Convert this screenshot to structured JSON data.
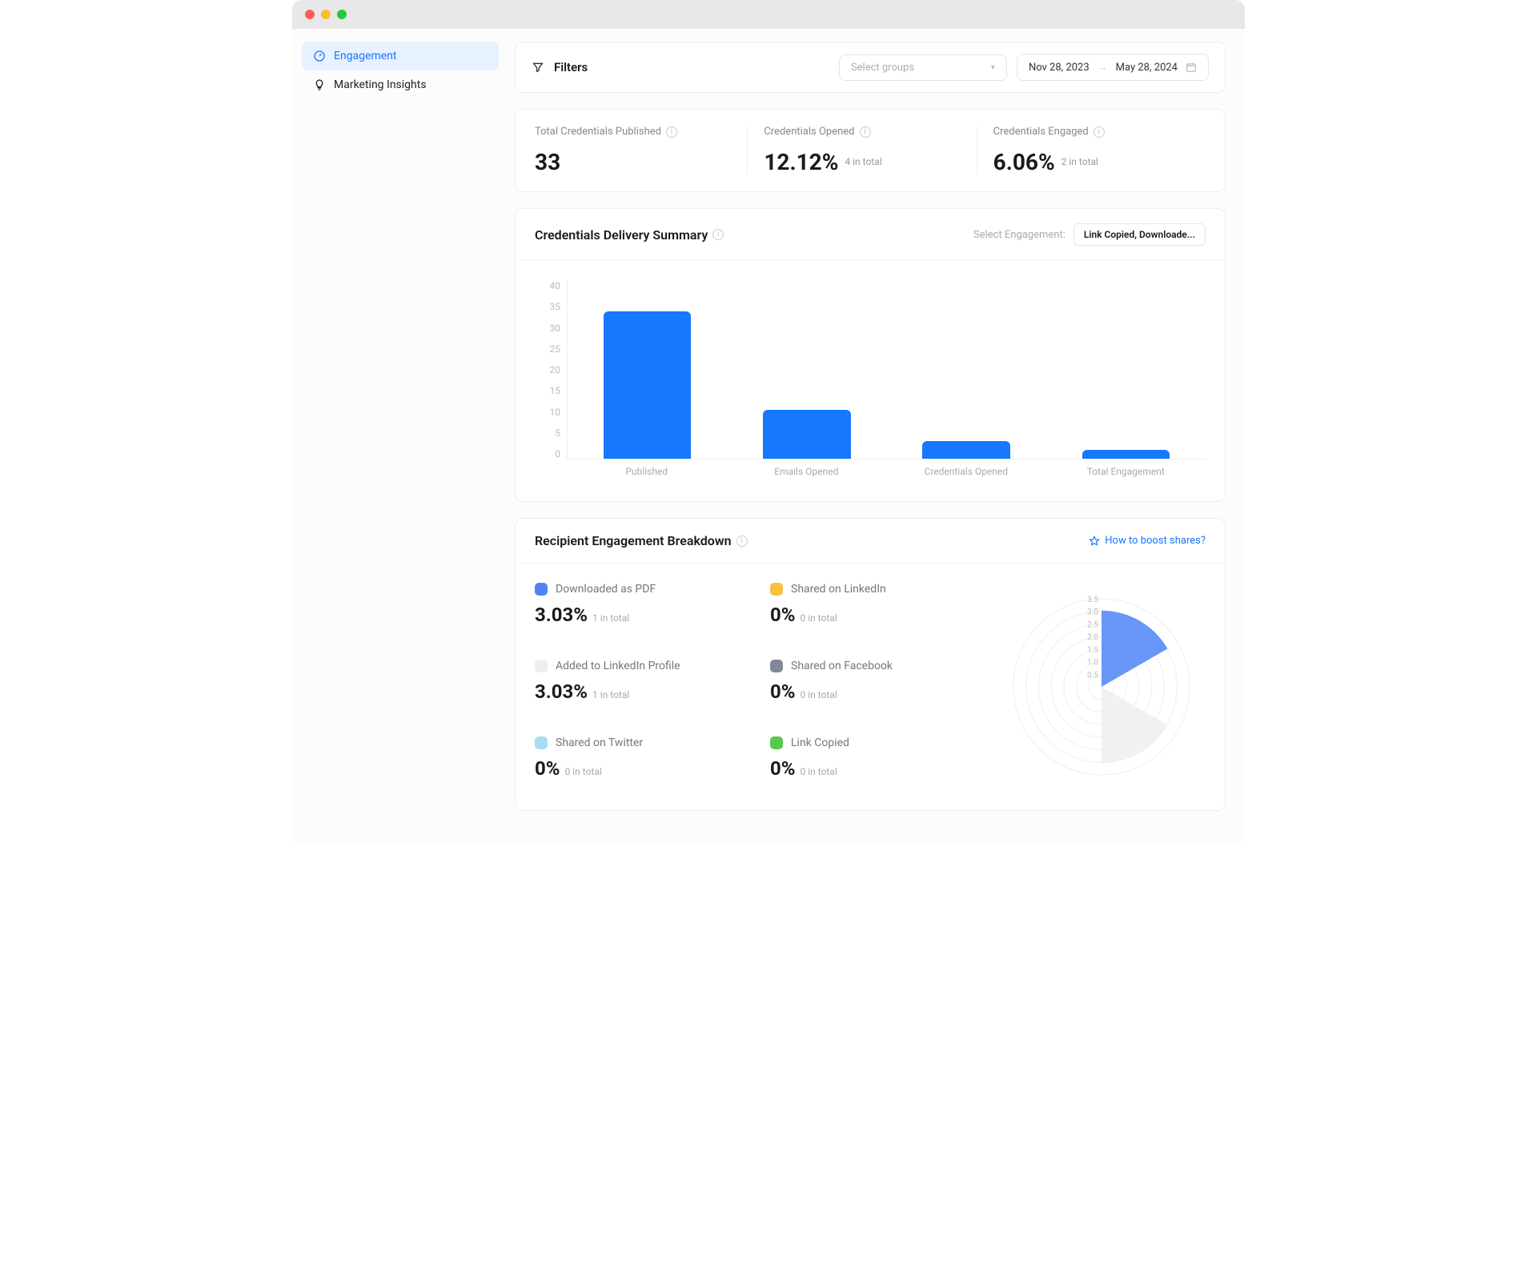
{
  "sidebar": {
    "items": [
      {
        "label": "Engagement",
        "active": true
      },
      {
        "label": "Marketing Insights",
        "active": false
      }
    ]
  },
  "filters": {
    "title": "Filters",
    "group_placeholder": "Select groups",
    "date_from": "Nov 28, 2023",
    "date_to": "May 28, 2024"
  },
  "stats": [
    {
      "label": "Total Credentials Published",
      "value": "33",
      "sub": ""
    },
    {
      "label": "Credentials Opened",
      "value": "12.12%",
      "sub": "4 in total"
    },
    {
      "label": "Credentials Engaged",
      "value": "6.06%",
      "sub": "2 in total"
    }
  ],
  "delivery": {
    "title": "Credentials Delivery Summary",
    "select_label": "Select Engagement:",
    "select_value": "Link Copied, Downloade..."
  },
  "breakdown": {
    "title": "Recipient Engagement Breakdown",
    "boost_label": "How to boost shares?",
    "items": [
      {
        "label": "Downloaded as PDF",
        "color": "#4e85f6",
        "pct": "3.03%",
        "sub": "1 in total"
      },
      {
        "label": "Shared on LinkedIn",
        "color": "#f6c043",
        "pct": "0%",
        "sub": "0 in total"
      },
      {
        "label": "Added to LinkedIn Profile",
        "color": "#eeeeee",
        "pct": "3.03%",
        "sub": "1 in total"
      },
      {
        "label": "Shared on Facebook",
        "color": "#818898",
        "pct": "0%",
        "sub": "0 in total"
      },
      {
        "label": "Shared on Twitter",
        "color": "#a7dcf3",
        "pct": "0%",
        "sub": "0 in total"
      },
      {
        "label": "Link Copied",
        "color": "#58c94a",
        "pct": "0%",
        "sub": "0 in total"
      }
    ]
  },
  "chart_data": [
    {
      "type": "bar",
      "title": "Credentials Delivery Summary",
      "categories": [
        "Published",
        "Emails Opened",
        "Credentials Opened",
        "Total Engagement"
      ],
      "values": [
        33,
        11,
        4,
        2
      ],
      "ylim": [
        0,
        40
      ],
      "yticks": [
        0,
        5,
        10,
        15,
        20,
        25,
        30,
        35,
        40
      ],
      "color": "#1677ff"
    },
    {
      "type": "radar",
      "title": "Recipient Engagement Breakdown",
      "categories": [
        "Downloaded as PDF",
        "Shared on LinkedIn",
        "Added to LinkedIn Profile",
        "Shared on Facebook",
        "Shared on Twitter",
        "Link Copied"
      ],
      "values": [
        3.03,
        0,
        3.03,
        0,
        0,
        0
      ],
      "rticks": [
        0.5,
        1.0,
        1.5,
        2.0,
        2.5,
        3.0,
        3.5
      ],
      "rmax": 3.5
    }
  ]
}
